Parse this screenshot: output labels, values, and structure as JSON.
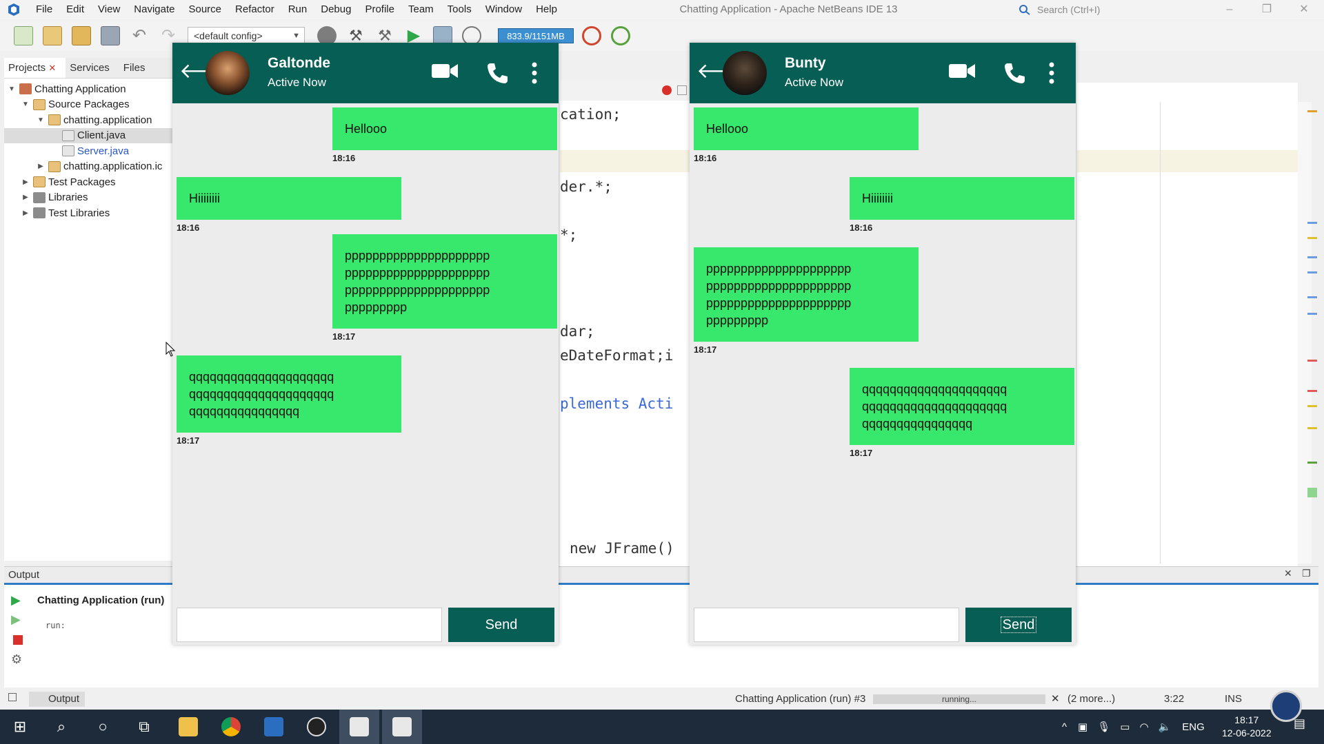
{
  "window": {
    "title": "Chatting Application - Apache NetBeans IDE 13",
    "search_placeholder": "Search (Ctrl+I)"
  },
  "menu": [
    "File",
    "Edit",
    "View",
    "Navigate",
    "Source",
    "Refactor",
    "Run",
    "Debug",
    "Profile",
    "Team",
    "Tools",
    "Window",
    "Help"
  ],
  "toolbar": {
    "config": "<default config>",
    "memory": "833.9/1151MB"
  },
  "projects_panel": {
    "tabs": [
      "Projects",
      "Services",
      "Files"
    ],
    "tree": [
      {
        "label": "Chatting Application"
      },
      {
        "label": "Source Packages"
      },
      {
        "label": "chatting.application"
      },
      {
        "label": "Client.java"
      },
      {
        "label": "Server.java"
      },
      {
        "label": "chatting.application.ic"
      },
      {
        "label": "Test Packages"
      },
      {
        "label": "Libraries"
      },
      {
        "label": "Test Libraries"
      }
    ]
  },
  "editor": {
    "lines": [
      "cation;",
      "der.*;",
      "*;",
      "dar;",
      "eDateFormat;i",
      "plements Acti",
      "new JFrame()"
    ]
  },
  "output": {
    "header": "Output",
    "title": "Chatting Application (run)",
    "text": "run:"
  },
  "status": {
    "output_tab": "Output",
    "run_label": "Chatting Application (run) #3",
    "progress_text": "running...",
    "more": "(2 more...)",
    "position": "3:22",
    "mode": "INS"
  },
  "taskbar": {
    "language": "ENG",
    "time": "18:17",
    "date": "12-06-2022"
  },
  "chat_left": {
    "name": "Galtonde",
    "status": "Active Now",
    "send_label": "Send",
    "messages": [
      {
        "lines": [
          "Hellooo"
        ],
        "time": "18:16"
      },
      {
        "lines": [
          "Hiiiiiiii"
        ],
        "time": "18:16"
      },
      {
        "lines": [
          "ppppppppppppppppppppp",
          "ppppppppppppppppppppp",
          "ppppppppppppppppppppp",
          "ppppppppp"
        ],
        "time": "18:17"
      },
      {
        "lines": [
          "qqqqqqqqqqqqqqqqqqqqq",
          "qqqqqqqqqqqqqqqqqqqqq",
          "qqqqqqqqqqqqqqqq"
        ],
        "time": "18:17"
      }
    ]
  },
  "chat_right": {
    "name": "Bunty",
    "status": "Active Now",
    "send_label": "Send",
    "messages": [
      {
        "lines": [
          "Hellooo"
        ],
        "time": "18:16"
      },
      {
        "lines": [
          "Hiiiiiiii"
        ],
        "time": "18:16"
      },
      {
        "lines": [
          "ppppppppppppppppppppp",
          "ppppppppppppppppppppp",
          "ppppppppppppppppppppp",
          "ppppppppp"
        ],
        "time": "18:17"
      },
      {
        "lines": [
          "qqqqqqqqqqqqqqqqqqqqq",
          "qqqqqqqqqqqqqqqqqqqqq",
          "qqqqqqqqqqqqqqqq"
        ],
        "time": "18:17"
      }
    ]
  },
  "colors": {
    "header_green": "#075e54",
    "bubble_green": "#37e86c"
  }
}
